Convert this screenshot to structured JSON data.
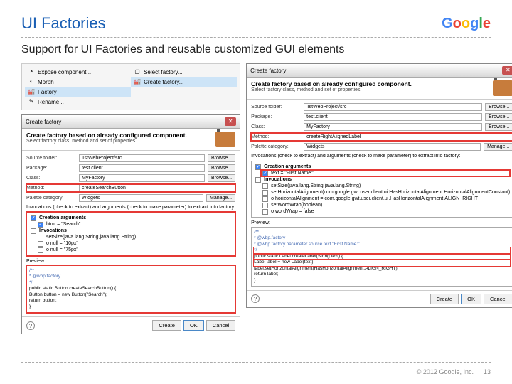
{
  "title": "UI Factories",
  "subtitle": "Support for UI Factories and reusable customized GUI elements",
  "logo": "Google",
  "footer": {
    "copyright": "© 2012 Google, Inc.",
    "page": "13"
  },
  "menu_left": [
    {
      "icon": "◔",
      "label": "Expose component..."
    },
    {
      "icon": "◐",
      "label": "Morph"
    },
    {
      "icon": "🏭",
      "label": "Factory"
    },
    {
      "icon": "✎",
      "label": "Rename..."
    }
  ],
  "menu_right": [
    {
      "icon": "▢",
      "label": "Select factory..."
    },
    {
      "icon": "🏭",
      "label": "Create factory..."
    }
  ],
  "dialog": {
    "title": "Create factory",
    "close": "✕",
    "header_title": "Create factory based on already configured component.",
    "header_sub": "Select factory class, method and set of properties.",
    "labels": {
      "source": "Source folder:",
      "package": "Package:",
      "class": "Class:",
      "method": "Method:",
      "palette": "Palette category:"
    },
    "buttons": {
      "browse": "Browse...",
      "manage": "Manage..."
    },
    "invocations_label": "Invocations (check to extract) and arguments (check to make parameter) to extract into factory:",
    "preview_label": "Preview:",
    "footer_help": "?",
    "footer_buttons": {
      "create": "Create",
      "ok": "OK",
      "cancel": "Cancel"
    }
  },
  "left": {
    "values": {
      "source": "TstWebProject/src",
      "package": "test.client",
      "class": "MyFactory",
      "method": "createSearchButton",
      "palette": "Widgets"
    },
    "tree": {
      "g1": "Creation arguments",
      "g1_items": [
        "html = \"Search\""
      ],
      "g2": "Invocations",
      "g2_items": [
        "setSize(java.lang.String,java.lang.String)",
        "o null = \"10px\"",
        "o null = \"75px\""
      ]
    },
    "code": [
      {
        "cls": "jd",
        "text": "/**"
      },
      {
        "cls": "jd",
        "text": " * @wbp.factory"
      },
      {
        "cls": "jd",
        "text": " */"
      },
      {
        "cls": "",
        "text": "public static Button createSearchButton() {"
      },
      {
        "cls": "",
        "text": "  Button button = new Button(\"Search\");"
      },
      {
        "cls": "",
        "text": "  return button;"
      },
      {
        "cls": "",
        "text": "}"
      }
    ]
  },
  "right": {
    "values": {
      "source": "TstWebProject/src",
      "package": "test.client",
      "class": "MyFactory",
      "method": "createRightAlignedLabel",
      "palette": "Widgets"
    },
    "tree": {
      "g1": "Creation arguments",
      "g1_items": [
        "text = \"First Name:\""
      ],
      "g2": "Invocations",
      "g2_items": [
        "setSize(java.lang.String,java.lang.String)",
        "setHorizontalAlignment(com.google.gwt.user.client.ui.HasHorizontalAlignment.HorizontalAlignmentConstant)",
        "o horizontalAlignment = com.google.gwt.user.client.ui.HasHorizontalAlignment.ALIGN_RIGHT",
        "setWordWrap(boolean)",
        "o wordWrap = false"
      ]
    },
    "code": [
      {
        "cls": "jd",
        "text": "/**"
      },
      {
        "cls": "jd",
        "text": " * @wbp.factory"
      },
      {
        "cls": "jd",
        "text": " * @wbp.factory.parameter.source text \"First Name:\""
      },
      {
        "cls": "jd",
        "text": " */"
      },
      {
        "cls": "",
        "text": "public static Label createLabel(String text) {"
      },
      {
        "cls": "",
        "text": "  Label label = new Label(text);"
      },
      {
        "cls": "",
        "text": "  label.setHorizontalAlignment(HasHorizontalAlignment.ALIGN_RIGHT);"
      },
      {
        "cls": "",
        "text": "  return label;"
      },
      {
        "cls": "",
        "text": "}"
      }
    ]
  }
}
